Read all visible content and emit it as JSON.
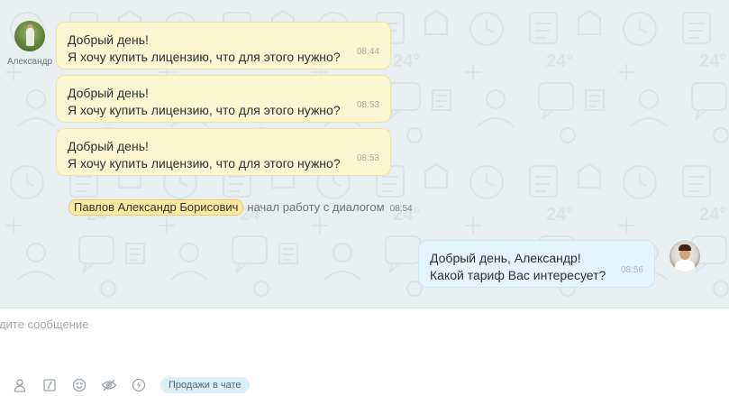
{
  "chat": {
    "client": {
      "name": "Александр",
      "avatar": "client-avatar"
    },
    "messages": [
      {
        "line1": "Добрый день!",
        "line2": "Я хочу купить лицензию, что для этого нужно?",
        "time": "08:44"
      },
      {
        "line1": "Добрый день!",
        "line2": "Я хочу купить лицензию, что для этого нужно?",
        "time": "08:53"
      },
      {
        "line1": "Добрый день!",
        "line2": "Я хочу купить лицензию, что для этого нужно?",
        "time": "08:53"
      }
    ],
    "system_event": {
      "operator_name": "Павлов Александр Борисович",
      "action": "начал работу с диалогом",
      "time": "08:54"
    },
    "reply": {
      "line1": "Добрый день, Александр!",
      "line2": "Какой тариф Вас интересует?",
      "time": "08:56"
    }
  },
  "composer": {
    "placeholder": "едите сообщение",
    "value": "",
    "tools": [
      {
        "icon": "user-icon"
      },
      {
        "icon": "quick-answers-icon"
      },
      {
        "icon": "smile-icon"
      },
      {
        "icon": "hidden-message-icon"
      },
      {
        "icon": "lightning-icon"
      }
    ],
    "sales_chip_label": "Продажи в чате"
  },
  "colors": {
    "chat_background": "#e9eef1",
    "client_bubble": "#fbf6d0",
    "operator_bubble": "#e4f4fc",
    "operator_tag": "#fde8a0",
    "sales_chip": "#dceef7"
  }
}
